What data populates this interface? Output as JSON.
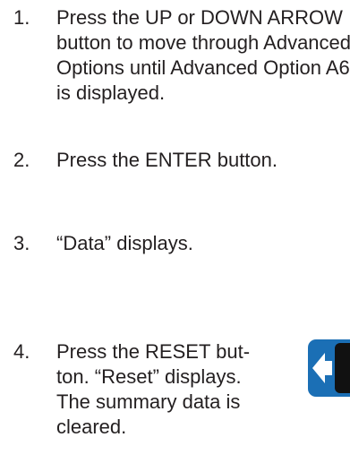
{
  "steps": [
    {
      "number": "1.",
      "text": "Press the UP or DOWN ARROW button to move through Advanced Options until Advanced Option A6 is displayed."
    },
    {
      "number": "2.",
      "text": "Press the ENTER button."
    },
    {
      "number": "3.",
      "text": "“Data” displays."
    },
    {
      "number": "4.",
      "text": "Press the RESET but- ton. “Reset” displays. The summary data is cleared."
    }
  ],
  "icons": {
    "reset_button_icon": "reset-arrow-icon",
    "colors": {
      "icon_blue": "#1b6fb5",
      "icon_black": "#111111",
      "text": "#231f20"
    }
  }
}
